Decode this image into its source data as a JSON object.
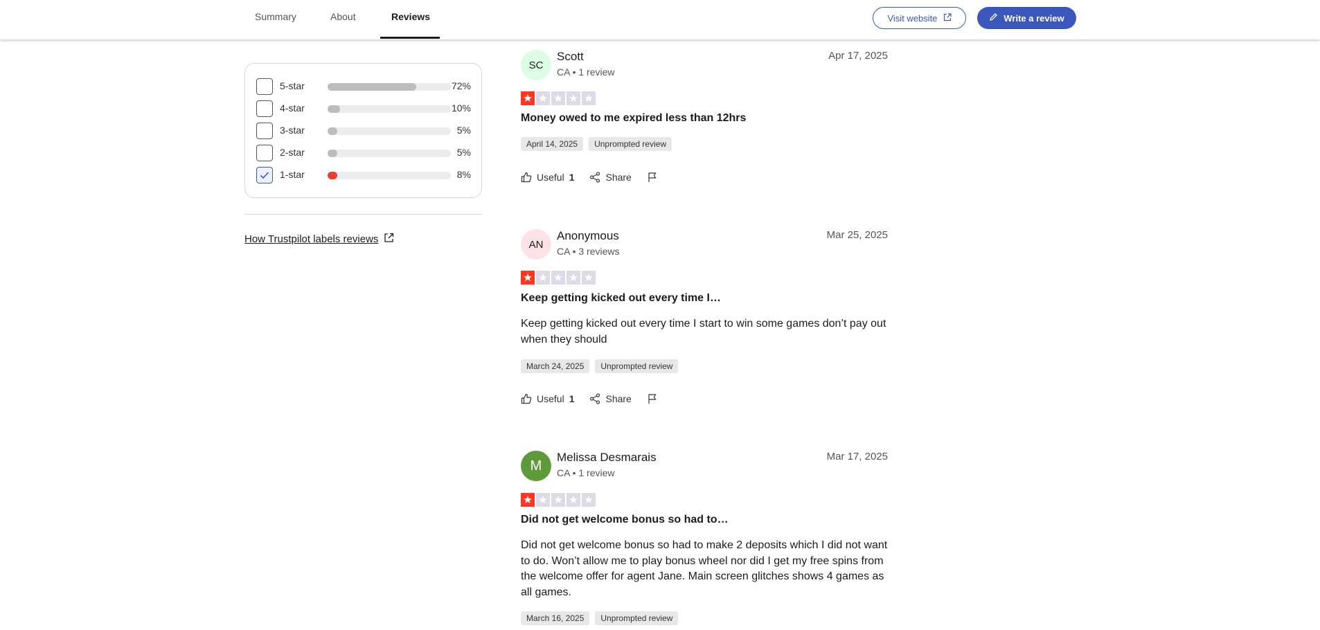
{
  "nav": {
    "tabs": [
      {
        "label": "Summary"
      },
      {
        "label": "About"
      },
      {
        "label": "Reviews"
      }
    ],
    "visit_label": "Visit website",
    "write_label": "Write a review"
  },
  "filters": {
    "rows": [
      {
        "label": "5-star",
        "percent": "72%",
        "fill": 0.72,
        "checked": false
      },
      {
        "label": "4-star",
        "percent": "10%",
        "fill": 0.1,
        "checked": false
      },
      {
        "label": "3-star",
        "percent": "5%",
        "fill": 0.05,
        "checked": false
      },
      {
        "label": "2-star",
        "percent": "5%",
        "fill": 0.05,
        "checked": false
      },
      {
        "label": "1-star",
        "percent": "8%",
        "fill": 0.08,
        "checked": true
      }
    ],
    "how_link": "How Trustpilot labels reviews"
  },
  "colors": {
    "brand_blue": "#3c57bc",
    "star_red": "#ff3722",
    "star_empty": "#dcdce6"
  },
  "reviews": [
    {
      "initials": "SC",
      "avatar_color": "#dcfce4",
      "name": "Scott",
      "meta": "CA • 1 review",
      "date": "Apr 17, 2025",
      "rating": 1,
      "title": "Money owed to me expired less than 12hrs",
      "body": "",
      "experience_date": "April 14, 2025",
      "tag": "Unprompted review",
      "useful_label": "Useful",
      "useful_count": "1",
      "share_label": "Share"
    },
    {
      "initials": "AN",
      "avatar_color": "#fde2e8",
      "name": "Anonymous",
      "meta": "CA • 3 reviews",
      "date": "Mar 25, 2025",
      "rating": 1,
      "title": "Keep getting kicked out every time I…",
      "body": "Keep getting kicked out every time I start to win some games don’t pay out when they should",
      "experience_date": "March 24, 2025",
      "tag": "Unprompted review",
      "useful_label": "Useful",
      "useful_count": "1",
      "share_label": "Share"
    },
    {
      "initials": "M",
      "avatar_color": "#5e9a3a",
      "name": "Melissa Desmarais",
      "meta": "CA • 1 review",
      "date": "Mar 17, 2025",
      "rating": 1,
      "title": "Did not get welcome bonus so had to…",
      "body": "Did not get welcome bonus so had to make 2 deposits which I did not want to do. Won’t allow me to play bonus wheel nor did I get my free spins from the welcome offer for agent Jane. Main screen glitches shows 4 games as all games.",
      "experience_date": "March 16, 2025",
      "tag": "Unprompted review"
    }
  ]
}
